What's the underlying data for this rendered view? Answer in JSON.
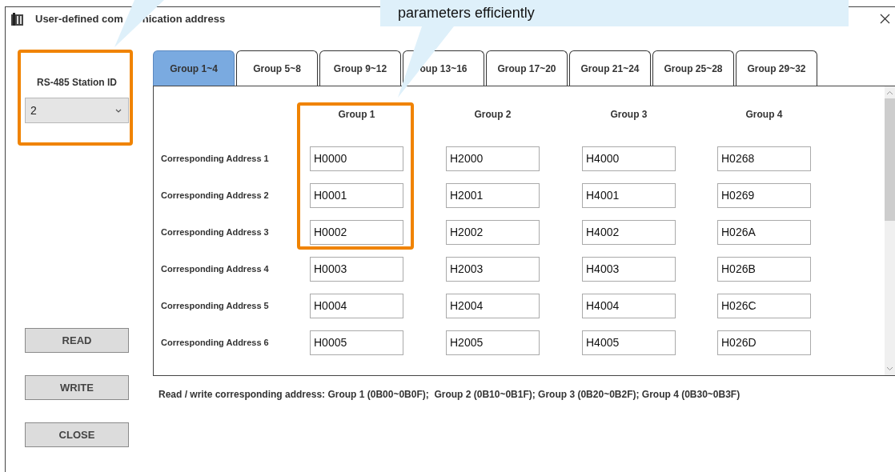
{
  "window": {
    "title_segments": [
      "User-defined com",
      "nication address"
    ]
  },
  "callout": {
    "text": "parameters efficiently"
  },
  "station": {
    "label": "RS-485 Station ID",
    "value": "2"
  },
  "buttons": [
    "READ",
    "WRITE",
    "CLOSE"
  ],
  "tabs": [
    {
      "label": "Group 1~4",
      "selected": true
    },
    {
      "label": "Group 5~8",
      "selected": false
    },
    {
      "label": "Group 9~12",
      "selected": false
    },
    {
      "label": "oup 13~16",
      "selected": false
    },
    {
      "label": "Group 17~20",
      "selected": false
    },
    {
      "label": "Group 21~24",
      "selected": false
    },
    {
      "label": "Group 25~28",
      "selected": false
    },
    {
      "label": "Group 29~32",
      "selected": false
    }
  ],
  "grid": {
    "columns": [
      "Group 1",
      "Group 2",
      "Group 3",
      "Group 4"
    ],
    "rows": [
      {
        "label": "Corresponding Address 1",
        "values": [
          "H0000",
          "H2000",
          "H4000",
          "H0268"
        ]
      },
      {
        "label": "Corresponding Address 2",
        "values": [
          "H0001",
          "H2001",
          "H4001",
          "H0269"
        ]
      },
      {
        "label": "Corresponding Address 3",
        "values": [
          "H0002",
          "H2002",
          "H4002",
          "H026A"
        ]
      },
      {
        "label": "Corresponding Address 4",
        "values": [
          "H0003",
          "H2003",
          "H4003",
          "H026B"
        ]
      },
      {
        "label": "Corresponding Address 5",
        "values": [
          "H0004",
          "H2004",
          "H4004",
          "H026C"
        ]
      },
      {
        "label": "Corresponding Address 6",
        "values": [
          "H0005",
          "H2005",
          "H4005",
          "H026D"
        ]
      }
    ]
  },
  "note": "Read / write corresponding address: Group 1 (0B00~0B0F);  Group 2 (0B10~0B1F); Group 3 (0B20~0B2F); Group 4 (0B30~0B3F)"
}
